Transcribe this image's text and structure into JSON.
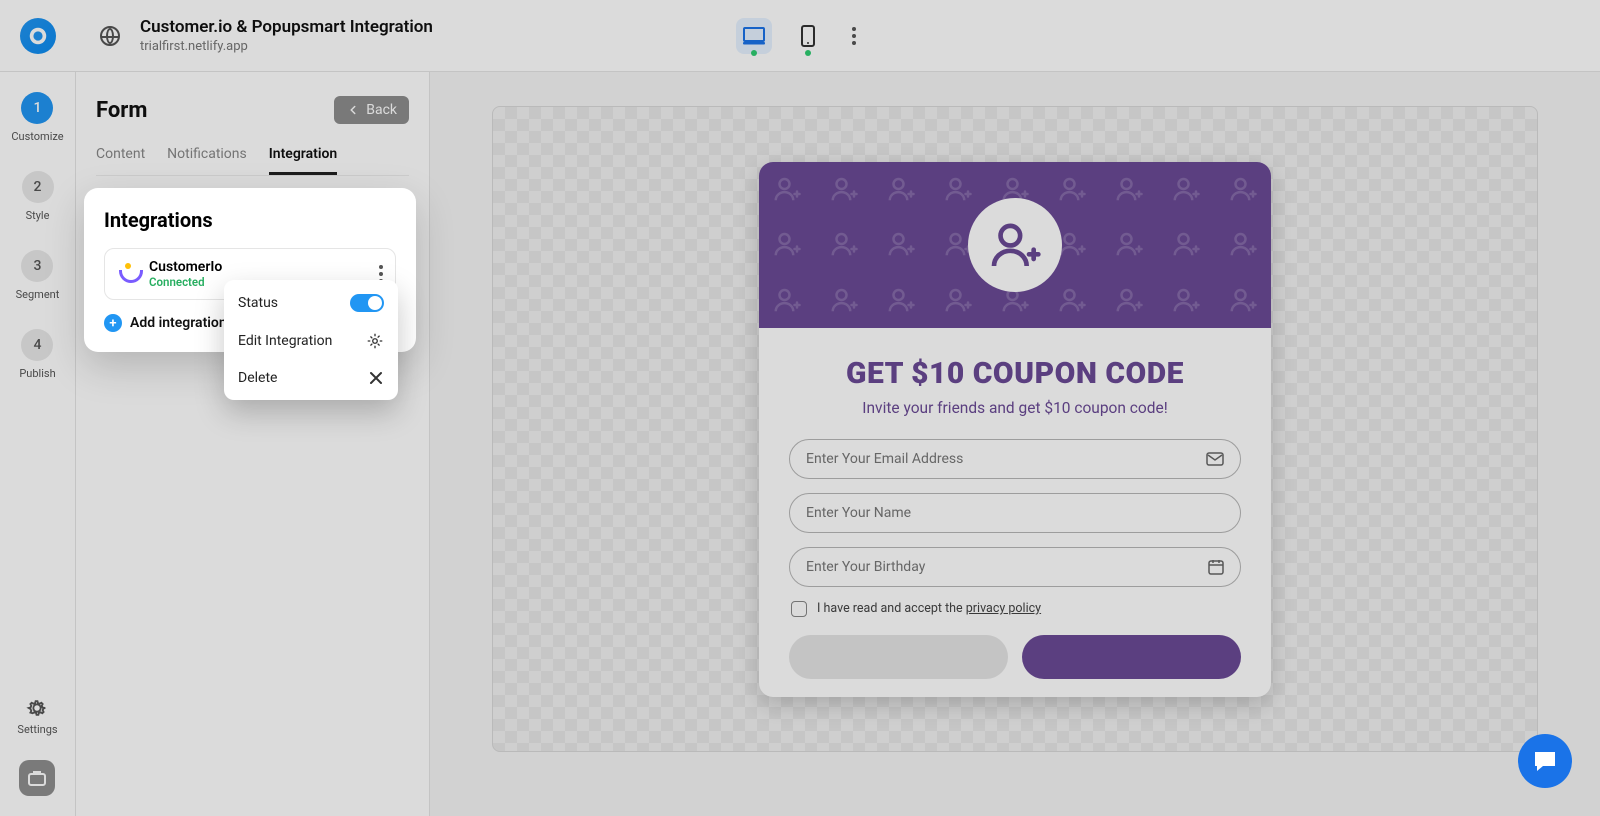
{
  "header": {
    "title": "Customer.io & Popupsmart Integration",
    "subtitle": "trialfirst.netlify.app"
  },
  "rail": {
    "steps": [
      {
        "num": "1",
        "label": "Customize"
      },
      {
        "num": "2",
        "label": "Style"
      },
      {
        "num": "3",
        "label": "Segment"
      },
      {
        "num": "4",
        "label": "Publish"
      }
    ],
    "settings": "Settings"
  },
  "panel": {
    "title": "Form",
    "back": "Back",
    "tabs": {
      "content": "Content",
      "notifications": "Notifications",
      "integration": "Integration"
    }
  },
  "integrations": {
    "heading": "Integrations",
    "item": {
      "name": "CustomerIo",
      "status": "Connected"
    },
    "add": "Add integration"
  },
  "dropdown": {
    "status": "Status",
    "edit": "Edit Integration",
    "delete": "Delete"
  },
  "popup": {
    "headline": "GET $10 COUPON CODE",
    "subhead": "Invite your friends and get $10 coupon code!",
    "email_ph": "Enter Your Email Address",
    "name_ph": "Enter Your Name",
    "birthday_ph": "Enter Your Birthday",
    "consent_pre": "I have read and accept the ",
    "consent_link": "privacy policy"
  }
}
